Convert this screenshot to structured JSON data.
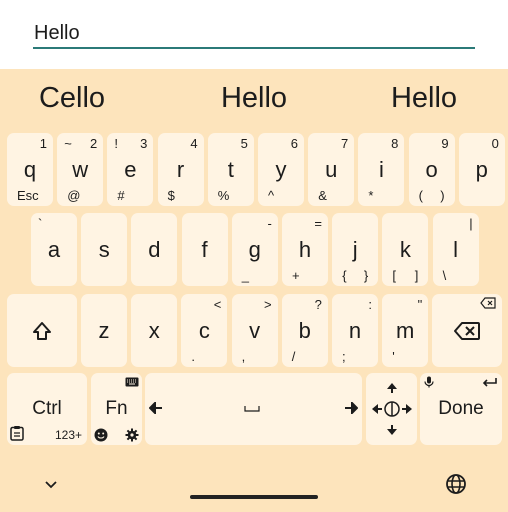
{
  "input": {
    "value": "Hello"
  },
  "suggestions": [
    "Cello",
    "Hello",
    "Hello"
  ],
  "row1": [
    {
      "main": "q",
      "tr": "1",
      "bl": "Esc"
    },
    {
      "main": "w",
      "tl": "~",
      "tr": "2",
      "bl": "@"
    },
    {
      "main": "e",
      "tl": "!",
      "tr": "3",
      "bl": "#"
    },
    {
      "main": "r",
      "tr": "4",
      "bl": "$"
    },
    {
      "main": "t",
      "tr": "5",
      "bl": "%"
    },
    {
      "main": "y",
      "tr": "6",
      "bl": "^"
    },
    {
      "main": "u",
      "tr": "7",
      "bl": "&"
    },
    {
      "main": "i",
      "tr": "8",
      "bl": "*"
    },
    {
      "main": "o",
      "tr": "9",
      "bl": "(",
      "br": ")"
    },
    {
      "main": "p",
      "tr": "0"
    }
  ],
  "row2": [
    {
      "main": "a",
      "tl": "`"
    },
    {
      "main": "s"
    },
    {
      "main": "d"
    },
    {
      "main": "f"
    },
    {
      "main": "g",
      "tr": "-",
      "bl": "_"
    },
    {
      "main": "h",
      "tr": "=",
      "bl": "+"
    },
    {
      "main": "j",
      "bl": "{",
      "br": "}"
    },
    {
      "main": "k",
      "bl": "[",
      "br": "]"
    },
    {
      "main": "l",
      "tr": "|",
      "bl": "\\"
    }
  ],
  "row3": [
    {
      "main": "z"
    },
    {
      "main": "x"
    },
    {
      "main": "c",
      "tr": "<",
      "bl": "."
    },
    {
      "main": "v",
      "tr": ">",
      "bl": ","
    },
    {
      "main": "b",
      "tr": "?",
      "bl": "/"
    },
    {
      "main": "n",
      "tr": ":",
      "bl": ";"
    },
    {
      "main": "m",
      "tr": "\"",
      "bl": "'"
    }
  ],
  "bottom": {
    "ctrl": "Ctrl",
    "fn": "Fn",
    "num": "123+",
    "done": "Done"
  },
  "colors": {
    "background": "#fde4bc",
    "key": "#fff4e3",
    "accent": "#2b7a78"
  }
}
